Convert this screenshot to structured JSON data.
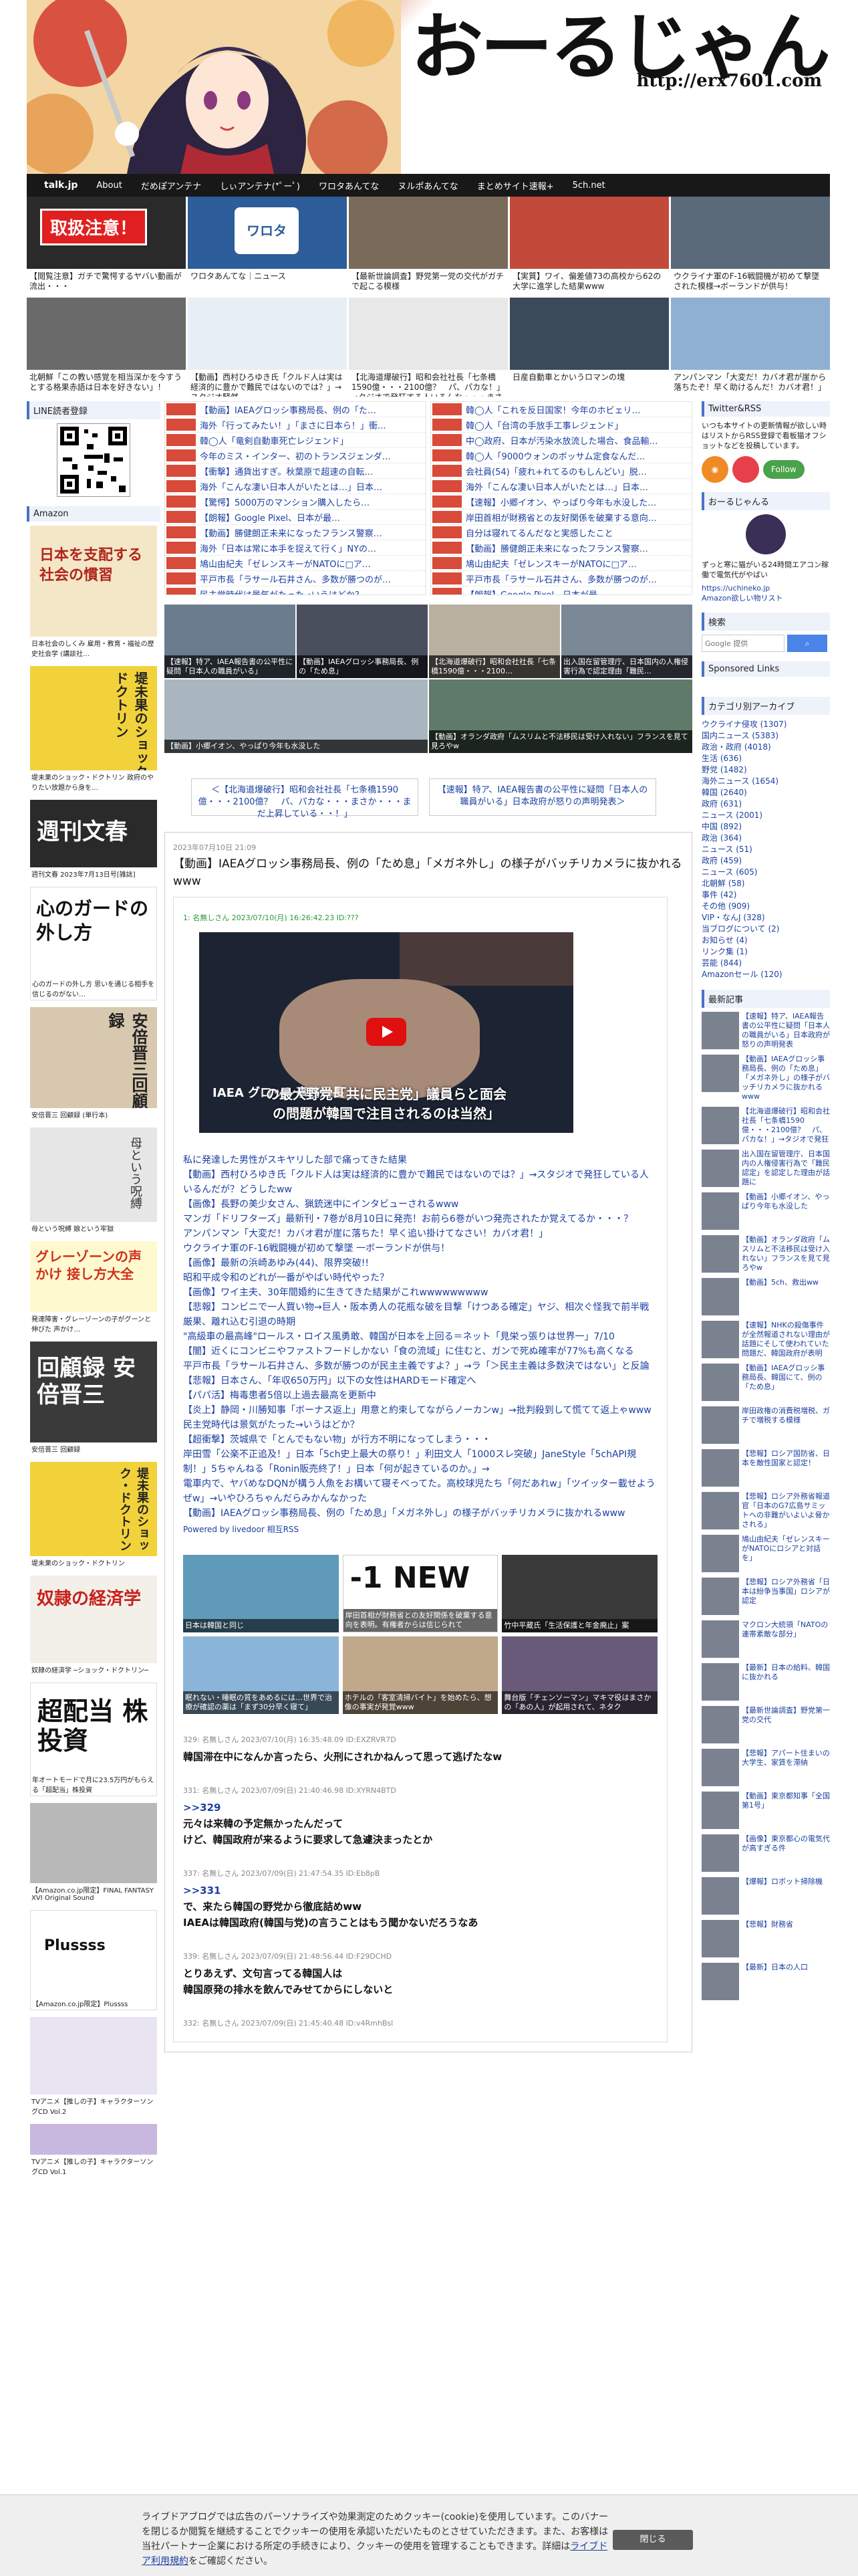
{
  "site": {
    "title": "おーるじゃんる",
    "url": "http://erx7601.com"
  },
  "nav": {
    "items": [
      "talk.jp",
      "About",
      "だめぽアンテナ",
      "しぃアンテナ(*ﾟーﾟ)",
      "ワロタあんてな",
      "ヌルポあんてな",
      "まとめサイト速報+",
      "5ch.net"
    ]
  },
  "featured": [
    {
      "label": "【閲覧注意】ガチで驚愕するヤバい動画が流出・・・",
      "img_text": "取扱注意！"
    },
    {
      "label": "ワロタあんてな｜ニュース",
      "img_text": "ワロタ"
    },
    {
      "label": "【最新世論調査】野党第一党の交代がガチで起こる模様",
      "img_text": ""
    },
    {
      "label": "【実質】ワイ、偏差値73の高校から62の大学に進学した結果www",
      "img_text": ""
    },
    {
      "label": "ウクライナ軍のF-16戦闘機が初めて撃墜された模様→ボーランドが供与！",
      "img_text": ""
    },
    {
      "label": "北朝鮮「この教い感覚を相当深かを今すうとする格果赤語は日本を好きない」！",
      "img_text": ""
    },
    {
      "label": "【動画】西村ひろゆき氏「クルド人は実は経済的に豊かで難民ではないのでは？」→スタジオ騒然",
      "img_text": ""
    },
    {
      "label": "【北海道爆破行】昭和会社社長「七条橋1590億・・・2100億？　パ、パカな！」→タジオで発狂する人いるんな・・・まさか・・まだ上昇している・・！",
      "img_text": ""
    },
    {
      "label": "日産自動車とかいうロマンの塊",
      "img_text": ""
    },
    {
      "label": "アンパンマン「大変だ！カバオ君が崖から落ちたぞ！早く助けるんだ！カバオ君！」",
      "img_text": ""
    }
  ],
  "left": {
    "line_title": "LINE読者登録",
    "amazon_title": "Amazon",
    "books": [
      {
        "title": "日本を支配する社会の慣習",
        "cap": "日本社会のしくみ 雇用・教育・福祉の歴史社会学 (講談社…"
      },
      {
        "title": "堤未果のショック・ドクトリン",
        "cap": "堤未果のショック・ドクトリン 政府のやりたい放題から身を…"
      },
      {
        "title": "週刊文春",
        "cap": "週刊文春 2023年7月13日号[雑誌]"
      },
      {
        "title": "心のガードの外し方",
        "cap": "心のガードの外し方 思いを通じる相手を信じるのがない…"
      },
      {
        "title": "安倍晋三回顧録",
        "cap": "安倍晋三 回顧録 (単行本)"
      },
      {
        "title": "母という呪縛",
        "cap": "母という呪縛 娘という牢獄"
      },
      {
        "title": "グレーゾーンの声かけ 接し方大全",
        "cap": "発達障害・グレーゾーンの子がグーンと伸びた 声かけ…"
      },
      {
        "title": "回顧録 安倍晋三",
        "cap": "安倍晋三 回顧録"
      },
      {
        "title": "堤未果のショック・ドクトリン",
        "cap": "堤未果のショック・ドクトリン"
      },
      {
        "title": "奴隷の経済学",
        "cap": "奴隷の経済学 ─ショック・ドクトリン─"
      },
      {
        "title": "超配当 株投資",
        "cap": "年オートモードで月に23.5万円がもらえる「超配当」株投資"
      },
      {
        "title": "FINAL FANTASY XVI",
        "cap": "【Amazon.co.jp限定】FINAL FANTASY XVI Original Sound"
      },
      {
        "title": "Plussss",
        "cap": "【Amazon.co.jp限定】Plussss"
      },
      {
        "title": "推しの子",
        "cap": "TVアニメ【推しの子】キャラクターソングCD Vol.2"
      },
      {
        "title": "推しの子",
        "cap": "TVアニメ【推しの子】キャラクターソングCD Vol.1"
      }
    ]
  },
  "rss_left": [
    "【動画】IAEAグロッシ事務局長、例の「た…",
    "海外「行ってみたい！」「まさに日本ら！」衝…",
    "韓◯人「竜剣自動車死亡レジェンド」",
    "今年のミス・インター、初のトランスジェンダ…",
    "【衝撃】通貨出すぎ。秋葉原で超速の自転…",
    "海外「こんな凄い日本人がいたとは…」日本…",
    "【驚愕】5000万のマンション購入したら…",
    "【朗報】Google Pixel、日本が最…",
    "【動画】勝健朗正未来になったフランス警察…",
    "海外「日本は常に本手を捉えて行く」NYの…",
    "鳩山由紀夫「ゼレンスキーがNATOに□ア…",
    "平戸市長「ラサール石井さん、多数が勝つのが…",
    "民主党時代は景気がたった→いうはどか？",
    "【超衝撃】茨城県で「とんでもない物」が行方…",
    "岸辺雪「公楽不正追及！」日本「5ch史上最…",
    "【速報】特急、IAEA報告書の公平性に疑…"
  ],
  "rss_right": [
    "韓◯人「これを反日国家！今年のホビェリ…",
    "韓◯人「台湾の手放手工事レジェンド」",
    "中◯政府、日本が汚染水放流した場合、食品輸…",
    "韓◯人「9000ウォンのボッサム定食なんだ…",
    "会社員(54)「疲れ+れてるのもしんどい」脱…",
    "海外「こんな凄い日本人がいたとは…」日本…",
    "【速報】小郷イオン、やっぱり今年も水没した…",
    "岸田首相が財務省との友好関係を破棄する意向…",
    "自分は寝れてるんだなと実感したこと",
    "【動画】勝健朗正未来になったフランス警察…",
    "鳩山由紀夫「ゼレンスキーがNATOに□ア…",
    "平戸市長「ラサール石井さん、多数が勝つのが…",
    "【朗報】Google Pixel、日本が最…",
    "【動画】IAEAグロッシ事務局長、例の「た…",
    "オタク「ドラゴンボールのセロゲリの意味を…",
    "平戸市長「ラサール石井さん、多数が勝つのが…"
  ],
  "grid4": [
    "【速報】特ア、IAEA報告書の公平性に疑問「日本人の職員がいる」",
    "【動画】IAEAグロッシ事務局長、例の「ため息」",
    "【北海道爆破行】昭和会社社長「七条橋1590億・・・2100…",
    "出入国在留管理庁、日本国内の人権侵害行為で認定理由「難民…",
    "【動画】小郷イオン、やっぱり今年も水没した",
    "【動画】オランダ政府「ムスリムと不法移民は受け入れない」フランスを見て見ろやw"
  ],
  "pager": {
    "prev": "＜【北海道爆破行】昭和会社社長「七条橋1590億・・・2100億？　パ、パカな・・・まさか・・・まだ上昇している・・！」",
    "next": "【速報】特ア、IAEA報告書の公平性に疑問「日本人の職員がいる」日本政府が怒りの声明発表＞"
  },
  "article": {
    "date": "2023年07月10日 21:09",
    "title": "【動画】IAEAグロッシ事務局長、例の「ため息」「メガネ外し」の様子がバッチリカメラに抜かれるwww",
    "meta": "1: 名無しさん 2023/07/10(月) 16:26:42.23 ID:???",
    "video_caption": "の最大野党「共に民主党」議員らと面会\nの問題が韓国で注目されるのは当然」",
    "video_label": "IAEA グロッシ事務局長",
    "links": [
      "私に発達した男性がスキヤリした部で痛ってきた結果",
      "【動画】西村ひろゆき氏「クルド人は実は経済的に豊かで難民ではないのでは？」→スタジオで発狂している人いるんだが？どうしたww",
      "【画像】長野の美少女さん、猟銃迷中にインタビューされるwww",
      "マンガ「ドリフターズ」最新刊・7巻が8月10日に発売！お前ら6巻がいつ発売されたか覚えてるか・・・？",
      "アンパンマン「大変だ！カバオ君が崖に落ちた！早く追い掛けてなさい！カバオ君！」",
      "ウクライナ軍のF-16戦闘機が初めて撃墜 一ボーランドが供与！",
      "【画像】最新の浜崎あゆみ(44)、限界突破!!",
      "昭和平成令和のどれが一番がやばい時代やった？",
      "【画像】ワイ主夫、30年間婚約に生きてきた結果がこれwwwwwwwww",
      "【悲報】コンビニで一人買い物→巨人・阪本勇人の花瓶な破を目撃「けつある確定」ヤジ、相次ぐ怪我で前半戦厳果、離れ込む引退の時期",
      "\"高級車の最高峰\"ロールス・ロイス風勇敢、韓国が日本を上回る＝ネット「見栄っ張りは世界一」7/10",
      "【闇】近くにコンビニやファストフードしかない「食の流域」に住むと、ガンで死ぬ確率が77%も高くなる",
      "平戸市長「ラサール石井さん、多数が勝つのが民主主義ですよ？」→ラ「＞民主主義は多数決ではない」と反論",
      "【悲報】日本さん、「年収650万円」以下の女性はHARDモード確定へ",
      "【パパ活】梅毒患者5倍以上過去最高を更新中",
      "【炎上】静岡・川勝知事「ボーナス返上」用意と約束してながらノーカンw」→批判殺到して慌てて返上ゃwww",
      "民主党時代は景気がたった→いうはどか？",
      "【超衝撃】茨城県で「とんでもない物」が行方不明になってしまう・・・",
      "岸田雪「公楽不正追及！」日本「5ch史上最大の祭り！」利田文人「1000スレ突破」JaneStyle「5chAPI規制！」5ちゃんねる「Ronin販売終了！」日本「何が起きているのか。」→",
      "電車内で、ヤバめなDQNが構う人魚をお構いて寝そべってた。高校球児たち「何だあれw」「ツイッター載せようぜw」→いやひろちゃんだらみかんなかった",
      "【動画】IAEAグロッシ事務局長、例の「ため息」「メガネ外し」の様子がバッチリカメラに抜かれるwww"
    ],
    "powered": "Powered by livedoor 相互RSS"
  },
  "ads": [
    {
      "label": "日本は韓国と同じ"
    },
    {
      "label": "岸田首相が財務省との友好関係を破棄する意向を表明。有権者からは信じられて"
    },
    {
      "label": "竹中平蔵氏「生活保護と年金廃止」案"
    },
    {
      "label": "眠れない・睡眠の質をあめるには…世界で治療が確認の薬は「まず30分早く寝て」"
    },
    {
      "label": "ホテルの「客室清掃バイト」を始めたら、想像の事実が発覚www"
    },
    {
      "label": "舞台版「チェンソーマン」マキマ役はまさかの「あの人」が起用されて、ネタク"
    }
  ],
  "ad_big_text": "-1 NEW",
  "comments": [
    {
      "h": "329: 名無しさん 2023/07/10(月) 16:35:48.09 ID:EXZRVR7D",
      "lines": [
        "韓国滞在中になんか言ったら、火刑にされかねんって思って逃げたなw"
      ]
    },
    {
      "h": "331: 名無しさん 2023/07/09(日) 21:40:46.98 ID:XYRN4BTD",
      "lines": [
        ">>329",
        "元々は来韓の予定無かったんだって",
        "けど、韓国政府が来るように要求して急遽決まったとか"
      ],
      "link_first": true
    },
    {
      "h": "337: 名無しさん 2023/07/09(日) 21:47:54.35 ID:Eb8pB",
      "lines": [
        ">>331",
        "で、来たら韓国の野党から徹底詰めww",
        "IAEAは韓国政府(韓国与党)の言うことはもう聞かないだろうなあ"
      ],
      "link_first": true
    },
    {
      "h": "339: 名無しさん 2023/07/09(日) 21:48:56.44 ID:F29DCHD",
      "lines": [
        "とりあえず、文句言ってる韓国人は",
        "韓国原発の排水を飲んでみせてからにしないと"
      ]
    },
    {
      "h": "332: 名無しさん 2023/07/09(日) 21:45:40.48 ID:v4RmhBsl",
      "lines": [
        ""
      ]
    }
  ],
  "right": {
    "twitter_title": "Twitter&RSS",
    "twitter_text": "いつも本サイトの更新情報が欲しい時はリストからRSS登録で看板猫オフショットなどを投稿しています。",
    "follow_label": "Follow",
    "author_title": "おーるじゃんる",
    "author_text": "ずっと寒に猫がいる24時間エアコン稼働で電気代がやばい",
    "author_link1": "https://uchineko.jp",
    "author_link2": "Amazon欲しい物リスト",
    "search_title": "検索",
    "search_placeholder": "Google 提供",
    "sponsored_title": "Sponsored Links",
    "category_title": "カテゴリ別アーカイブ",
    "categories": [
      "ウクライナ侵攻 (1307)",
      "国内ニュース (5383)",
      "政治・政府 (4018)",
      "生活 (636)",
      "野党 (1482)",
      "海外ニュース (1654)",
      "韓国 (2640)",
      "政府 (631)",
      "ニュース (2001)",
      "中国 (892)",
      "政治 (364)",
      "ニュース (51)",
      "政府 (459)",
      "ニュース (605)",
      "北朝鮮 (58)",
      "事件 (42)",
      "その他 (909)",
      "VIP・なんJ (328)",
      "当ブログについて (2)",
      "お知らせ (4)",
      "リンク集 (1)",
      "芸能 (844)",
      "Amazonセール (120)"
    ],
    "recent_title": "最新記事",
    "recent": [
      "【速報】特ア、IAEA報告書の公平性に疑問「日本人の職員がいる」日本政府が怒りの声明発表",
      "【動画】IAEAグロッシ事務局長、例の「ため息」「メガネ外し」の様子がバッチリカメラに抜かれるwww",
      "【北海道爆破行】昭和会社社長「七条橋1590億・・・2100億？　パ、パカな！」→タジオで発狂",
      "出入国在留管理庁、日本国内の人権侵害行為で「難民認定」を認定した理由が話題に",
      "【動画】小郷イオン、やっぱり今年も水没した",
      "【動画】オランダ政府「ムスリムと不法移民は受け入れない」フランスを見て見ろやw",
      "【動画】5ch、救出ww",
      "【速報】NHKの殺傷事件が全然報道されない理由が話題にそして使われていた問題だ、韓国政府が表明",
      "【動画】IAEAグロッシ事務局長、韓国にて、例の「ため息」",
      "岸田政権の消費税増税、ガチで増税する模様",
      "【悲報】ロシア国防省、日本を敵性国家と認定！",
      "【悲報】ロシア外務省報道官「日本のG7広島サミットへの非難がいよいよ脅かされる」",
      "鳩山由紀夫「ゼレンスキーがNATOにロシアと対話を」",
      "【悲報】ロシア外務省「日本は紛争当事国」ロシアが認定",
      "マクロン大統領「NATOの連帯素敵な部分」",
      "【最新】日本の給料、韓国に抜かれる",
      "【最新世論調査】野党第一党の交代",
      "【悲報】アパート住まいの大学生、家賃を滞納",
      "【動画】東京都知事「全国第1号」",
      "【画像】東京都心の電気代が高すぎる件",
      "【爆報】ロボット掃除機",
      "【悲報】財務省",
      "【最新】日本の人口"
    ]
  },
  "cookie": {
    "text": "ライブドアブログでは広告のパーソナライズや効果測定のためクッキー(cookie)を使用しています。このバナーを閉じるか閲覧を継続することでクッキーの使用を承認いただいたものとさせていただきます。また、お客様は当社パートナー企業における所定の手続きにより、クッキーの使用を管理することもできます。詳細は",
    "link": "ライブドア利用規約",
    "suffix": "をご確認ください。",
    "button": "閉じる"
  },
  "colors": {
    "nav_bg": "#181818",
    "accent": "#4a74c4",
    "link": "#1a3fa0",
    "badge_red": "#d84a3a"
  }
}
